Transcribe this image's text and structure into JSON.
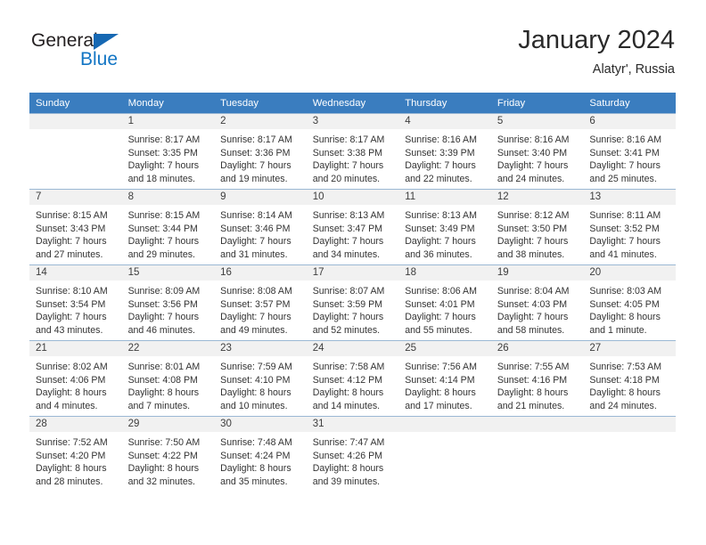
{
  "brand": {
    "name_top": "General",
    "name_bottom": "Blue",
    "accent_color": "#1275c4",
    "triangle_color": "#1668b3"
  },
  "header": {
    "title": "January 2024",
    "subtitle": "Alatyr', Russia"
  },
  "theme": {
    "header_row_bg": "#3a7dbf",
    "daynum_bg": "#f1f1f1",
    "grid_line": "#9bb8d4"
  },
  "weekdays": [
    "Sunday",
    "Monday",
    "Tuesday",
    "Wednesday",
    "Thursday",
    "Friday",
    "Saturday"
  ],
  "weeks": [
    [
      {
        "day": "",
        "lines": []
      },
      {
        "day": "1",
        "lines": [
          "Sunrise: 8:17 AM",
          "Sunset: 3:35 PM",
          "Daylight: 7 hours",
          "and 18 minutes."
        ]
      },
      {
        "day": "2",
        "lines": [
          "Sunrise: 8:17 AM",
          "Sunset: 3:36 PM",
          "Daylight: 7 hours",
          "and 19 minutes."
        ]
      },
      {
        "day": "3",
        "lines": [
          "Sunrise: 8:17 AM",
          "Sunset: 3:38 PM",
          "Daylight: 7 hours",
          "and 20 minutes."
        ]
      },
      {
        "day": "4",
        "lines": [
          "Sunrise: 8:16 AM",
          "Sunset: 3:39 PM",
          "Daylight: 7 hours",
          "and 22 minutes."
        ]
      },
      {
        "day": "5",
        "lines": [
          "Sunrise: 8:16 AM",
          "Sunset: 3:40 PM",
          "Daylight: 7 hours",
          "and 24 minutes."
        ]
      },
      {
        "day": "6",
        "lines": [
          "Sunrise: 8:16 AM",
          "Sunset: 3:41 PM",
          "Daylight: 7 hours",
          "and 25 minutes."
        ]
      }
    ],
    [
      {
        "day": "7",
        "lines": [
          "Sunrise: 8:15 AM",
          "Sunset: 3:43 PM",
          "Daylight: 7 hours",
          "and 27 minutes."
        ]
      },
      {
        "day": "8",
        "lines": [
          "Sunrise: 8:15 AM",
          "Sunset: 3:44 PM",
          "Daylight: 7 hours",
          "and 29 minutes."
        ]
      },
      {
        "day": "9",
        "lines": [
          "Sunrise: 8:14 AM",
          "Sunset: 3:46 PM",
          "Daylight: 7 hours",
          "and 31 minutes."
        ]
      },
      {
        "day": "10",
        "lines": [
          "Sunrise: 8:13 AM",
          "Sunset: 3:47 PM",
          "Daylight: 7 hours",
          "and 34 minutes."
        ]
      },
      {
        "day": "11",
        "lines": [
          "Sunrise: 8:13 AM",
          "Sunset: 3:49 PM",
          "Daylight: 7 hours",
          "and 36 minutes."
        ]
      },
      {
        "day": "12",
        "lines": [
          "Sunrise: 8:12 AM",
          "Sunset: 3:50 PM",
          "Daylight: 7 hours",
          "and 38 minutes."
        ]
      },
      {
        "day": "13",
        "lines": [
          "Sunrise: 8:11 AM",
          "Sunset: 3:52 PM",
          "Daylight: 7 hours",
          "and 41 minutes."
        ]
      }
    ],
    [
      {
        "day": "14",
        "lines": [
          "Sunrise: 8:10 AM",
          "Sunset: 3:54 PM",
          "Daylight: 7 hours",
          "and 43 minutes."
        ]
      },
      {
        "day": "15",
        "lines": [
          "Sunrise: 8:09 AM",
          "Sunset: 3:56 PM",
          "Daylight: 7 hours",
          "and 46 minutes."
        ]
      },
      {
        "day": "16",
        "lines": [
          "Sunrise: 8:08 AM",
          "Sunset: 3:57 PM",
          "Daylight: 7 hours",
          "and 49 minutes."
        ]
      },
      {
        "day": "17",
        "lines": [
          "Sunrise: 8:07 AM",
          "Sunset: 3:59 PM",
          "Daylight: 7 hours",
          "and 52 minutes."
        ]
      },
      {
        "day": "18",
        "lines": [
          "Sunrise: 8:06 AM",
          "Sunset: 4:01 PM",
          "Daylight: 7 hours",
          "and 55 minutes."
        ]
      },
      {
        "day": "19",
        "lines": [
          "Sunrise: 8:04 AM",
          "Sunset: 4:03 PM",
          "Daylight: 7 hours",
          "and 58 minutes."
        ]
      },
      {
        "day": "20",
        "lines": [
          "Sunrise: 8:03 AM",
          "Sunset: 4:05 PM",
          "Daylight: 8 hours",
          "and 1 minute."
        ]
      }
    ],
    [
      {
        "day": "21",
        "lines": [
          "Sunrise: 8:02 AM",
          "Sunset: 4:06 PM",
          "Daylight: 8 hours",
          "and 4 minutes."
        ]
      },
      {
        "day": "22",
        "lines": [
          "Sunrise: 8:01 AM",
          "Sunset: 4:08 PM",
          "Daylight: 8 hours",
          "and 7 minutes."
        ]
      },
      {
        "day": "23",
        "lines": [
          "Sunrise: 7:59 AM",
          "Sunset: 4:10 PM",
          "Daylight: 8 hours",
          "and 10 minutes."
        ]
      },
      {
        "day": "24",
        "lines": [
          "Sunrise: 7:58 AM",
          "Sunset: 4:12 PM",
          "Daylight: 8 hours",
          "and 14 minutes."
        ]
      },
      {
        "day": "25",
        "lines": [
          "Sunrise: 7:56 AM",
          "Sunset: 4:14 PM",
          "Daylight: 8 hours",
          "and 17 minutes."
        ]
      },
      {
        "day": "26",
        "lines": [
          "Sunrise: 7:55 AM",
          "Sunset: 4:16 PM",
          "Daylight: 8 hours",
          "and 21 minutes."
        ]
      },
      {
        "day": "27",
        "lines": [
          "Sunrise: 7:53 AM",
          "Sunset: 4:18 PM",
          "Daylight: 8 hours",
          "and 24 minutes."
        ]
      }
    ],
    [
      {
        "day": "28",
        "lines": [
          "Sunrise: 7:52 AM",
          "Sunset: 4:20 PM",
          "Daylight: 8 hours",
          "and 28 minutes."
        ]
      },
      {
        "day": "29",
        "lines": [
          "Sunrise: 7:50 AM",
          "Sunset: 4:22 PM",
          "Daylight: 8 hours",
          "and 32 minutes."
        ]
      },
      {
        "day": "30",
        "lines": [
          "Sunrise: 7:48 AM",
          "Sunset: 4:24 PM",
          "Daylight: 8 hours",
          "and 35 minutes."
        ]
      },
      {
        "day": "31",
        "lines": [
          "Sunrise: 7:47 AM",
          "Sunset: 4:26 PM",
          "Daylight: 8 hours",
          "and 39 minutes."
        ]
      },
      {
        "day": "",
        "lines": []
      },
      {
        "day": "",
        "lines": []
      },
      {
        "day": "",
        "lines": []
      }
    ]
  ]
}
